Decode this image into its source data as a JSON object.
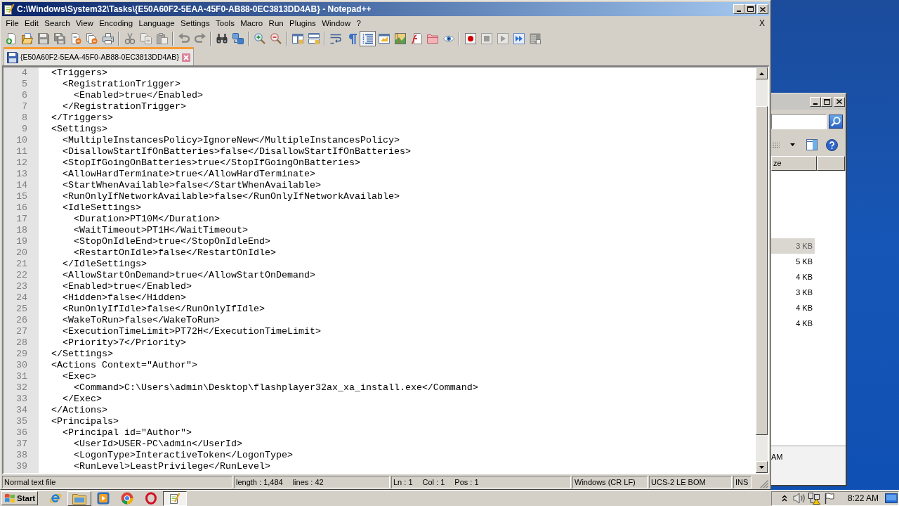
{
  "window": {
    "title": "C:\\Windows\\System32\\Tasks\\{E50A60F2-5EAA-45F0-AB88-0EC3813DD4AB} - Notepad++"
  },
  "menu": {
    "items": [
      "File",
      "Edit",
      "Search",
      "View",
      "Encoding",
      "Language",
      "Settings",
      "Tools",
      "Macro",
      "Run",
      "Plugins",
      "Window",
      "?"
    ],
    "close_label": "X"
  },
  "toolbar": [
    {
      "on": false,
      "disabled": false
    },
    {
      "on": false,
      "disabled": false
    },
    {
      "on": false,
      "disabled": true
    },
    {
      "on": false,
      "disabled": true
    },
    {
      "on": false,
      "disabled": false
    },
    {
      "on": false,
      "disabled": false
    },
    {
      "on": false,
      "disabled": false
    },
    {
      "on": false,
      "disabled": true
    },
    {
      "on": false,
      "disabled": true
    },
    {
      "on": false,
      "disabled": true
    },
    {
      "on": false,
      "disabled": true
    },
    {
      "on": false,
      "disabled": true
    },
    {
      "on": false,
      "disabled": false
    },
    {
      "on": false,
      "disabled": false
    },
    {
      "on": false,
      "disabled": false
    },
    {
      "on": false,
      "disabled": false
    },
    {
      "on": false,
      "disabled": false
    },
    {
      "on": false,
      "disabled": false
    },
    {
      "on": false,
      "disabled": false
    },
    {
      "on": false,
      "disabled": false
    },
    {
      "on": true,
      "disabled": false
    },
    {
      "on": false,
      "disabled": false
    },
    {
      "on": false,
      "disabled": false
    },
    {
      "on": false,
      "disabled": false
    },
    {
      "on": false,
      "disabled": false
    },
    {
      "on": false,
      "disabled": false
    },
    {
      "on": false,
      "disabled": false
    },
    {
      "on": false,
      "disabled": true
    },
    {
      "on": false,
      "disabled": true
    },
    {
      "on": false,
      "disabled": false
    },
    {
      "on": false,
      "disabled": true
    }
  ],
  "tabs": [
    {
      "label": "{E50A60F2-5EAA-45F0-AB88-0EC3813DD4AB}",
      "selected": true,
      "modified": false
    }
  ],
  "editor": {
    "lines": [
      {
        "number": "4",
        "text": "  <Triggers>"
      },
      {
        "number": "5",
        "text": "    <RegistrationTrigger>"
      },
      {
        "number": "6",
        "text": "      <Enabled>true</Enabled>"
      },
      {
        "number": "7",
        "text": "    </RegistrationTrigger>"
      },
      {
        "number": "8",
        "text": "  </Triggers>"
      },
      {
        "number": "9",
        "text": "  <Settings>"
      },
      {
        "number": "10",
        "text": "    <MultipleInstancesPolicy>IgnoreNew</MultipleInstancesPolicy>"
      },
      {
        "number": "11",
        "text": "    <DisallowStartIfOnBatteries>false</DisallowStartIfOnBatteries>"
      },
      {
        "number": "12",
        "text": "    <StopIfGoingOnBatteries>true</StopIfGoingOnBatteries>"
      },
      {
        "number": "13",
        "text": "    <AllowHardTerminate>true</AllowHardTerminate>"
      },
      {
        "number": "14",
        "text": "    <StartWhenAvailable>false</StartWhenAvailable>"
      },
      {
        "number": "15",
        "text": "    <RunOnlyIfNetworkAvailable>false</RunOnlyIfNetworkAvailable>"
      },
      {
        "number": "16",
        "text": "    <IdleSettings>"
      },
      {
        "number": "17",
        "text": "      <Duration>PT10M</Duration>"
      },
      {
        "number": "18",
        "text": "      <WaitTimeout>PT1H</WaitTimeout>"
      },
      {
        "number": "19",
        "text": "      <StopOnIdleEnd>true</StopOnIdleEnd>"
      },
      {
        "number": "20",
        "text": "      <RestartOnIdle>false</RestartOnIdle>"
      },
      {
        "number": "21",
        "text": "    </IdleSettings>"
      },
      {
        "number": "22",
        "text": "    <AllowStartOnDemand>true</AllowStartOnDemand>"
      },
      {
        "number": "23",
        "text": "    <Enabled>true</Enabled>"
      },
      {
        "number": "24",
        "text": "    <Hidden>false</Hidden>"
      },
      {
        "number": "25",
        "text": "    <RunOnlyIfIdle>false</RunOnlyIfIdle>"
      },
      {
        "number": "26",
        "text": "    <WakeToRun>false</WakeToRun>"
      },
      {
        "number": "27",
        "text": "    <ExecutionTimeLimit>PT72H</ExecutionTimeLimit>"
      },
      {
        "number": "28",
        "text": "    <Priority>7</Priority>"
      },
      {
        "number": "29",
        "text": "  </Settings>"
      },
      {
        "number": "30",
        "text": "  <Actions Context=\"Author\">"
      },
      {
        "number": "31",
        "text": "    <Exec>"
      },
      {
        "number": "32",
        "text": "      <Command>C:\\Users\\admin\\Desktop\\flashplayer32ax_xa_install.exe</Command>"
      },
      {
        "number": "33",
        "text": "    </Exec>"
      },
      {
        "number": "34",
        "text": "  </Actions>"
      },
      {
        "number": "35",
        "text": "  <Principals>"
      },
      {
        "number": "36",
        "text": "    <Principal id=\"Author\">"
      },
      {
        "number": "37",
        "text": "      <UserId>USER-PC\\admin</UserId>"
      },
      {
        "number": "38",
        "text": "      <LogonType>InteractiveToken</LogonType>"
      },
      {
        "number": "39",
        "text": "      <RunLevel>LeastPrivilege</RunLevel>"
      }
    ]
  },
  "status_bar": [
    {
      "items": [
        "Normal text file"
      ]
    },
    {
      "items": [
        "length : 1,484",
        "lines : 42"
      ]
    },
    {
      "items": [
        "Ln : 1",
        "Col : 1",
        "Pos : 1"
      ]
    },
    {
      "items": [
        "Windows (CR LF)"
      ]
    },
    {
      "items": [
        "UCS-2 LE BOM"
      ]
    },
    {
      "items": [
        "INS"
      ]
    }
  ],
  "background_window": {
    "column_header": "ze",
    "rows": [
      {
        "size": "3 KB",
        "selected": true
      },
      {
        "size": "5 KB",
        "selected": false
      },
      {
        "size": "4 KB",
        "selected": false
      },
      {
        "size": "3 KB",
        "selected": false
      },
      {
        "size": "4 KB",
        "selected": false
      },
      {
        "size": "4 KB",
        "selected": false
      }
    ],
    "status_text": "AM"
  },
  "taskbar": {
    "start_label": "Start",
    "apps": [
      {
        "kind": "browser_e",
        "open": false,
        "selected": false
      },
      {
        "kind": "folder",
        "open": true,
        "selected": false
      },
      {
        "kind": "player",
        "open": false,
        "selected": false
      },
      {
        "kind": "browser_ring",
        "open": false,
        "selected": false
      },
      {
        "kind": "browser_o",
        "open": false,
        "selected": false
      },
      {
        "kind": "editor",
        "open": true,
        "selected": true
      }
    ],
    "clock": "8:22 AM"
  }
}
